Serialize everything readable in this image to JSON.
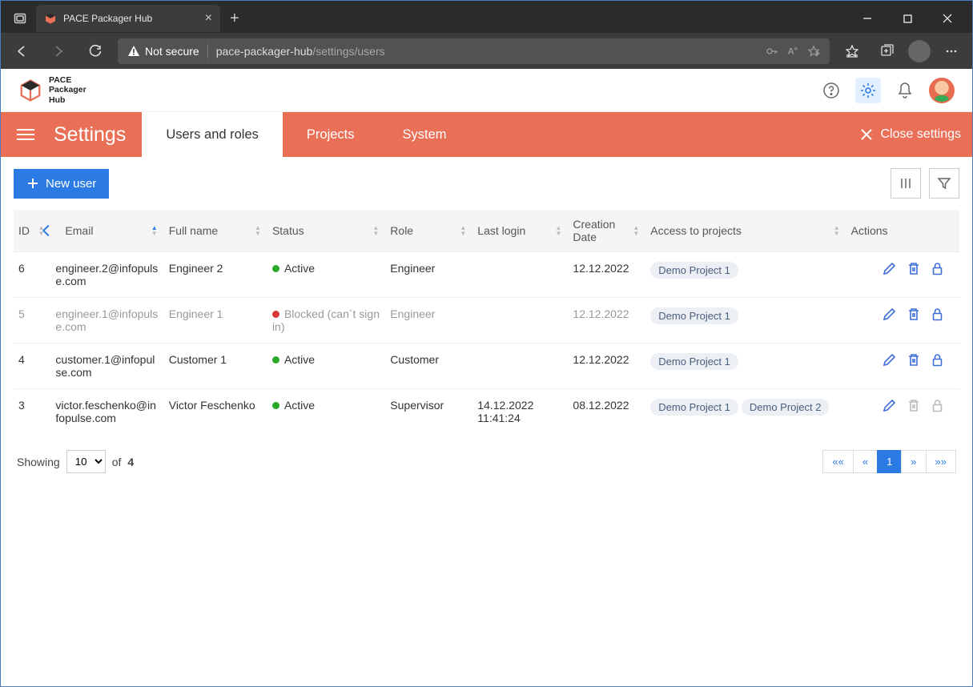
{
  "browser": {
    "tab_title": "PACE Packager Hub",
    "not_secure": "Not secure",
    "url_host": "pace-packager-hub",
    "url_path": "/settings/users"
  },
  "app": {
    "name_l1": "PACE",
    "name_l2": "Packager",
    "name_l3": "Hub"
  },
  "header": {
    "title": "Settings",
    "tabs": [
      "Users and roles",
      "Projects",
      "System"
    ],
    "close": "Close settings"
  },
  "toolbar": {
    "new_user": "New user"
  },
  "columns": {
    "id": "ID",
    "email": "Email",
    "fullname": "Full name",
    "status": "Status",
    "role": "Role",
    "lastlogin": "Last login",
    "creation": "Creation Date",
    "access": "Access to projects",
    "actions": "Actions"
  },
  "rows": [
    {
      "id": "6",
      "email": "engineer.2@infopulse.com",
      "name": "Engineer 2",
      "status": "Active",
      "statusKind": "active",
      "role": "Engineer",
      "lastlogin": "",
      "creation": "12.12.2022",
      "projects": [
        "Demo Project 1"
      ],
      "disabled": false,
      "actionsDisabled": false
    },
    {
      "id": "5",
      "email": "engineer.1@infopulse.com",
      "name": "Engineer 1",
      "status": "Blocked (can`t sign in)",
      "statusKind": "blocked",
      "role": "Engineer",
      "lastlogin": "",
      "creation": "12.12.2022",
      "projects": [
        "Demo Project 1"
      ],
      "disabled": true,
      "actionsDisabled": false
    },
    {
      "id": "4",
      "email": "customer.1@infopulse.com",
      "name": "Customer 1",
      "status": "Active",
      "statusKind": "active",
      "role": "Customer",
      "lastlogin": "",
      "creation": "12.12.2022",
      "projects": [
        "Demo Project 1"
      ],
      "disabled": false,
      "actionsDisabled": false
    },
    {
      "id": "3",
      "email": "victor.feschenko@infopulse.com",
      "name": "Victor Feschenko",
      "status": "Active",
      "statusKind": "active",
      "role": "Supervisor",
      "lastlogin": "14.12.2022 11:41:24",
      "creation": "08.12.2022",
      "projects": [
        "Demo Project 1",
        "Demo Project 2"
      ],
      "disabled": false,
      "actionsDisabled": true
    }
  ],
  "footer": {
    "showing": "Showing",
    "of": "of",
    "total": "4",
    "page_size": "10",
    "first": "««",
    "prev": "«",
    "page": "1",
    "next": "»",
    "last": "»»"
  }
}
